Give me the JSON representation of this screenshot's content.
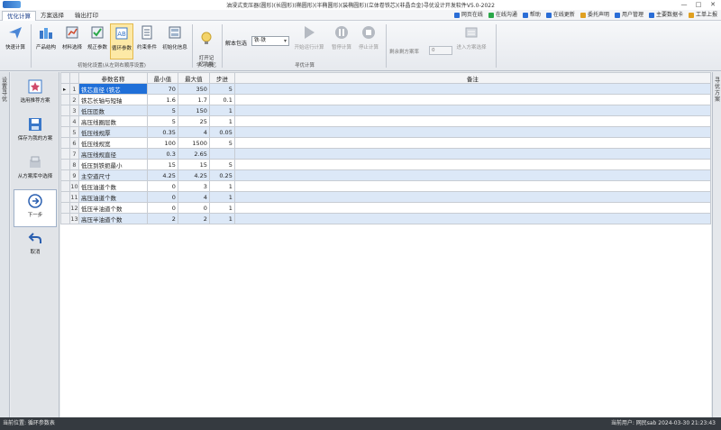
{
  "window": {
    "title": "油浸式变压器(圆形)(长圆形)(椭圆形)(半椭圆形)(装椭圆形)(立体卷铁芯)(非晶合金)寻优设计开发软件V5.0-2022",
    "controls": [
      "—",
      "□",
      "✕"
    ]
  },
  "menu": {
    "tabs": [
      "优化计算",
      "方案选择",
      "输出打印"
    ]
  },
  "quick_links": [
    {
      "label": "网页在线",
      "color": "#2a6dd6"
    },
    {
      "label": "在线沟通",
      "color": "#2ba84a"
    },
    {
      "label": "帮助",
      "color": "#2a6dd6"
    },
    {
      "label": "在线更新",
      "color": "#2a6dd6"
    },
    {
      "label": "委托声明",
      "color": "#e0a020"
    },
    {
      "label": "用户管理",
      "color": "#2a6dd6"
    },
    {
      "label": "主要数据卡",
      "color": "#2a6dd6"
    },
    {
      "label": "工单上报",
      "color": "#e0a020"
    }
  ],
  "ribbon": {
    "quick_calc": "快速计算",
    "product_structure": "产品结构",
    "material_select": "材料选择",
    "correction_params": "规正参数",
    "loop_params": "循环参数",
    "constraints": "约束条件",
    "init_info": "初始化信息",
    "group_init": "初始化设置(从左到右顺序设置)",
    "memory_func": "打开记\n忆功能",
    "group_memory": "学习记忆",
    "algo_label": "解本包选",
    "algo_value": "铁-铁",
    "start_calc": "开始运行计算",
    "pause_calc": "暂停计算",
    "stop_calc": "停止计算",
    "group_search": "寻优计算",
    "residual_label": "剩余剩方案率",
    "residual_value": "0",
    "enter_scheme": "进入方案选择"
  },
  "left_tab": "设置寻优",
  "right_tab": "寻优方案",
  "left_panel": [
    {
      "label": "选用推荐方案",
      "icon": "recommend-icon"
    },
    {
      "label": "保存为我的方案",
      "icon": "save-icon"
    },
    {
      "label": "从方案库中选择",
      "icon": "library-icon"
    },
    {
      "label": "下一步",
      "icon": "next-icon"
    },
    {
      "label": "取消",
      "icon": "cancel-icon"
    }
  ],
  "grid": {
    "headers": [
      "参数名称",
      "最小值",
      "最大值",
      "步进",
      "备注"
    ],
    "rows": [
      {
        "no": "1",
        "name": "铁芯直径 (铁芯",
        "min": "70",
        "max": "350",
        "step": "5"
      },
      {
        "no": "2",
        "name": "铁芯长轴与短轴",
        "min": "1.6",
        "max": "1.7",
        "step": "0.1"
      },
      {
        "no": "3",
        "name": "低压匝数",
        "min": "5",
        "max": "150",
        "step": "1"
      },
      {
        "no": "4",
        "name": "高压线圈层数",
        "min": "5",
        "max": "25",
        "step": "1"
      },
      {
        "no": "5",
        "name": "低压线规厚",
        "min": "0.35",
        "max": "4",
        "step": "0.05"
      },
      {
        "no": "6",
        "name": "低压线规宽",
        "min": "100",
        "max": "1500",
        "step": "5"
      },
      {
        "no": "7",
        "name": "高压线规直径",
        "min": "0.3",
        "max": "2.65",
        "step": ""
      },
      {
        "no": "8",
        "name": "低压到铁扼最小",
        "min": "15",
        "max": "15",
        "step": "5"
      },
      {
        "no": "9",
        "name": "主空道尺寸",
        "min": "4.25",
        "max": "4.25",
        "step": "0.25"
      },
      {
        "no": "10",
        "name": "低压油道个数",
        "min": "0",
        "max": "3",
        "step": "1"
      },
      {
        "no": "11",
        "name": "高压油道个数",
        "min": "0",
        "max": "4",
        "step": "1"
      },
      {
        "no": "12",
        "name": "低压半油道个数",
        "min": "0",
        "max": "0",
        "step": "1"
      },
      {
        "no": "13",
        "name": "高压半油道个数",
        "min": "2",
        "max": "2",
        "step": "1"
      }
    ]
  },
  "status": {
    "left": "当前位置: 循环参数表",
    "right": "当前用户: 网民sab    2024-03-30 21:23:43"
  }
}
